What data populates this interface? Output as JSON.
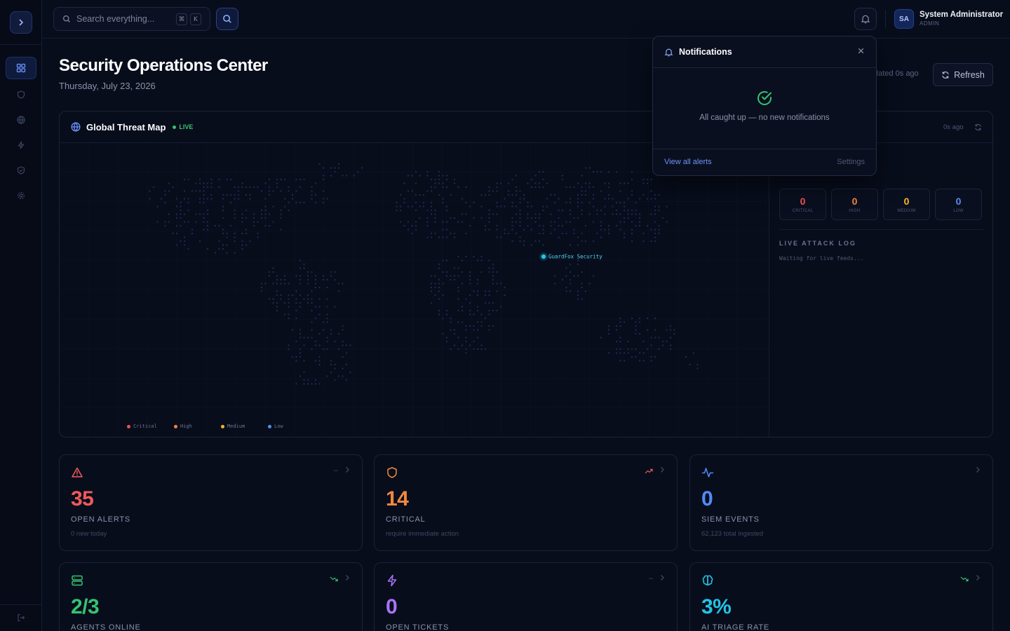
{
  "topbar": {
    "search_placeholder": "Search everything...",
    "kbd_cmd": "⌘",
    "kbd_key": "K",
    "user": {
      "initials": "SA",
      "name": "System Administrator",
      "role": "ADMIN"
    }
  },
  "sidebar": {
    "items": [
      {
        "icon": "grid-icon",
        "active": true
      },
      {
        "icon": "shield-icon",
        "active": false
      },
      {
        "icon": "globe-icon",
        "active": false
      },
      {
        "icon": "zap-icon",
        "active": false
      },
      {
        "icon": "shield-check-icon",
        "active": false
      },
      {
        "icon": "settings-icon",
        "active": false
      }
    ],
    "footer_icon": "logout-icon"
  },
  "page": {
    "title": "Security Operations Center",
    "date": "Thursday, July 23, 2026",
    "updated": "Updated 0s ago",
    "refresh_label": "Refresh"
  },
  "threat_map": {
    "title": "Global Threat Map",
    "live_label": "LIVE",
    "marker_label": "GuardFox Security",
    "legend": [
      {
        "label": "Critical",
        "color": "#f05252"
      },
      {
        "label": "High",
        "color": "#f0883e"
      },
      {
        "label": "Medium",
        "color": "#f5b52a"
      },
      {
        "label": "Low",
        "color": "#5b8def"
      }
    ],
    "panel_ago": "0s ago",
    "severity": [
      {
        "value": "0",
        "label": "CRITICAL",
        "color": "#f05252"
      },
      {
        "value": "0",
        "label": "HIGH",
        "color": "#f0883e"
      },
      {
        "value": "0",
        "label": "MEDIUM",
        "color": "#f5b52a"
      },
      {
        "value": "0",
        "label": "LOW",
        "color": "#5b8def"
      }
    ],
    "log_title": "LIVE ATTACK LOG",
    "log_waiting": "Waiting for live feeds..."
  },
  "notifications": {
    "title": "Notifications",
    "empty": "All caught up — no new notifications",
    "view_all": "View all alerts",
    "settings": "Settings"
  },
  "stats": [
    {
      "value": "35",
      "label": "OPEN ALERTS",
      "sub": "0 new today",
      "color": "#f05a5a",
      "trend": "–",
      "icon": "alert-triangle-icon"
    },
    {
      "value": "14",
      "label": "CRITICAL",
      "sub": "require immediate action",
      "color": "#f0883e",
      "trend": "up",
      "icon": "shield-icon"
    },
    {
      "value": "0",
      "label": "SIEM EVENTS",
      "sub": "62,123 total ingested",
      "color": "#4f8cf7",
      "trend": "",
      "icon": "activity-icon"
    },
    {
      "value": "2/3",
      "label": "AGENTS ONLINE",
      "sub": "",
      "color": "#34c370",
      "trend": "down",
      "icon": "server-icon"
    },
    {
      "value": "0",
      "label": "OPEN TICKETS",
      "sub": "",
      "color": "#a774f5",
      "trend": "–",
      "icon": "zap-icon"
    },
    {
      "value": "3%",
      "label": "AI TRIAGE RATE",
      "sub": "",
      "color": "#22c3e6",
      "trend": "down",
      "icon": "brain-icon"
    }
  ]
}
